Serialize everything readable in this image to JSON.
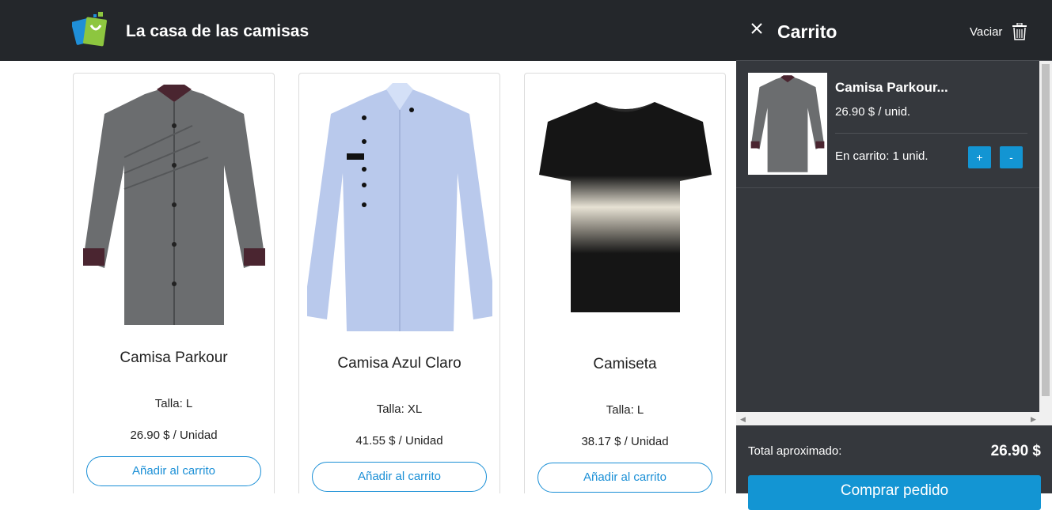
{
  "header": {
    "brand": "La casa de las camisas",
    "logo_icon": "shopping-bag-logo"
  },
  "products": [
    {
      "name": "Camisa Parkour",
      "size": "Talla: L",
      "price": "26.90 $ / Unidad",
      "add_label": "Añadir al carrito",
      "color": "#6b6d6f"
    },
    {
      "name": "Camisa Azul Claro",
      "size": "Talla: XL",
      "price": "41.55 $ / Unidad",
      "add_label": "Añadir al carrito",
      "color": "#b9c9ec"
    },
    {
      "name": "Camiseta",
      "size": "Talla: L",
      "price": "38.17 $ / Unidad",
      "add_label": "Añadir al carrito",
      "color": "#151515"
    }
  ],
  "cart": {
    "title": "Carrito",
    "clear_label": "Vaciar",
    "items": [
      {
        "name": "Camisa Parkour...",
        "unit_price": "26.90 $ / unid.",
        "quantity": "En carrito: 1 unid.",
        "plus": "+",
        "minus": "-"
      }
    ],
    "total_label": "Total aproximado:",
    "total_value": "26.90 $",
    "buy_label": "Comprar pedido"
  },
  "colors": {
    "header_bg": "#24272b",
    "cart_bg": "#35383d",
    "accent": "#1395d3"
  }
}
